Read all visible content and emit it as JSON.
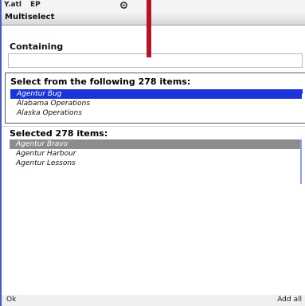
{
  "status_bar": {
    "signal": "Y.atl",
    "network": "EP",
    "center_icon": "gear-icon"
  },
  "title": "Multiselect",
  "containing": {
    "label": "Containing",
    "value": ""
  },
  "available": {
    "heading": "Select from the following 278 items:",
    "items": [
      {
        "label": "Agentur Bug",
        "highlighted": true
      },
      {
        "label": "Alabama Operations",
        "highlighted": false
      },
      {
        "label": "Alaska Operations",
        "highlighted": false
      }
    ]
  },
  "selected": {
    "heading": "Selected 278 items:",
    "items": [
      {
        "label": "Agentur Bravo",
        "highlighted": true
      },
      {
        "label": "Agentur Harbour",
        "highlighted": false
      },
      {
        "label": "Agentur Lessons",
        "highlighted": false
      }
    ]
  },
  "softkeys": {
    "left": "Ok",
    "right": "Add all"
  },
  "colors": {
    "frame_bg": "#4a58c4",
    "pointer": "#b0152a",
    "highlight_blue": "#1a34d8",
    "highlight_gray": "#8c8c8c"
  }
}
